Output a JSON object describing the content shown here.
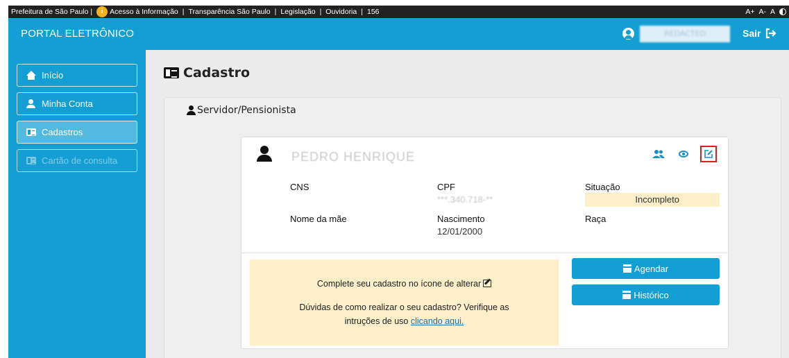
{
  "govbar": {
    "prefeitura": "Prefeitura de São Paulo |",
    "acesso": "Acesso à Informação",
    "transparencia": "Transparência São Paulo",
    "legislacao": "Legislação",
    "ouvidoria": "Ouvidoria",
    "phone": "156",
    "separator": "|",
    "font_increase": "A+",
    "font_decrease": "A-",
    "font_normal": "A"
  },
  "header": {
    "brand": "PORTAL ELETRÔNICO",
    "user_name": "REDACTED",
    "logout": "Sair"
  },
  "sidebar": {
    "items": [
      {
        "label": "Início",
        "icon": "home-icon"
      },
      {
        "label": "Minha Conta",
        "icon": "user-icon"
      },
      {
        "label": "Cadastros",
        "icon": "id-card-icon"
      },
      {
        "label": "Cartão de consulta",
        "icon": "id-card-icon"
      }
    ]
  },
  "main": {
    "title": "Cadastro",
    "section_title": "Servidor/Pensionista",
    "record": {
      "name": "PEDRO HENRIQUE",
      "cns_label": "CNS",
      "cpf_label": "CPF",
      "cpf_value": "***.340.718-**",
      "situacao_label": "Situação",
      "situacao_value": "Incompleto",
      "mae_label": "Nome da mãe",
      "nascimento_label": "Nascimento",
      "nascimento_value": "12/01/2000",
      "raca_label": "Raça"
    },
    "notice": {
      "line1": "Complete seu cadastro no ícone de alterar",
      "line2": "Dúvidas de como realizar o seu cadastro? Verifique as",
      "line3_prefix": "intruções de uso",
      "line3_link": "clicando aqui."
    },
    "buttons": {
      "agendar": "Agendar",
      "historico": "Histórico"
    }
  },
  "colors": {
    "primary_blue": "#139fd3",
    "notice_bg": "#fcefc9",
    "edit_highlight": "#d32020"
  }
}
